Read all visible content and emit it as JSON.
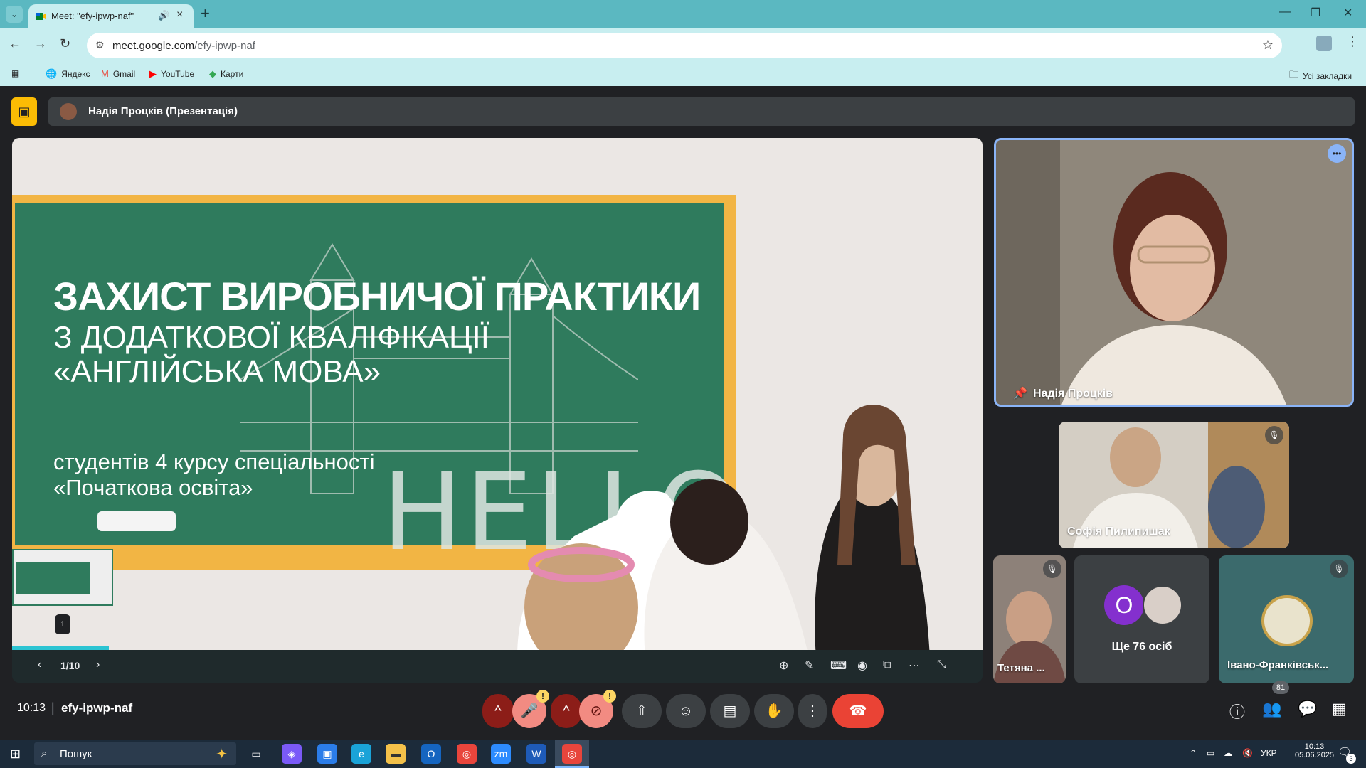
{
  "browser": {
    "tab_title": "Meet: \"efy-ipwp-naf\"",
    "url_host": "meet.google.com",
    "url_path": "/efy-ipwp-naf",
    "bookmarks": [
      {
        "label": "Яндекс",
        "icon": "yandex-icon"
      },
      {
        "label": "Gmail",
        "icon": "gmail-icon"
      },
      {
        "label": "YouTube",
        "icon": "youtube-icon"
      },
      {
        "label": "Карти",
        "icon": "maps-icon"
      }
    ],
    "all_bookmarks": "Усі закладки"
  },
  "meet": {
    "presenter_label": "Надія Процків (Презентація)",
    "slide": {
      "title": "ЗАХИСТ ВИРОБНИЧОЇ ПРАКТИКИ",
      "subtitle1": "З ДОДАТКОВОЇ КВАЛІФІКАЦІЇ",
      "subtitle2": "«АНГЛІЙСЬКА МОВА»",
      "students": "студентів 4 курсу спеціальності",
      "program": "«Початкова освіта»",
      "board_word": "HELLO",
      "page": "1/10",
      "thumb_badge": "1",
      "progress": 0.1
    },
    "participants": {
      "main": "Надія Процків",
      "sofia": "Софія Пилипишак",
      "tetiana": "Тетяна ...",
      "more_initial": "О",
      "more_label": "Ще 76 осіб",
      "ivano": "Івано-Франківськ..."
    },
    "bottom": {
      "time": "10:13",
      "separator": "|",
      "code": "efy-ipwp-naf",
      "people_count": "81"
    }
  },
  "taskbar": {
    "search_placeholder": "Пошук",
    "lang": "УКР",
    "time": "10:13",
    "date": "05.06.2025",
    "notif_count": "3"
  },
  "colors": {
    "tab_strip": "#5bb8c1",
    "toolbar": "#c8eef0",
    "meet_bg": "#202124",
    "present_yellow": "#fbbc04",
    "end_call_red": "#ea4335",
    "board_green": "#2f7b5d",
    "board_frame": "#f2b544"
  }
}
